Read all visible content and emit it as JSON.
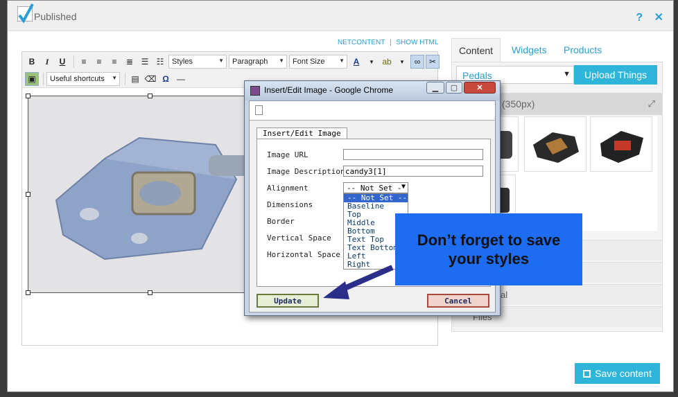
{
  "header": {
    "published_label": "Published"
  },
  "editor_links": {
    "netcontent": "NETCONTENT",
    "sep": "|",
    "show_html": "SHOW HTML"
  },
  "toolbar": {
    "bold": "B",
    "italic": "I",
    "underline": "U",
    "styles": "Styles",
    "paragraph": "Paragraph",
    "font_size": "Font Size",
    "text_color_glyph": "A",
    "shortcuts": "Useful shortcuts",
    "omega": "Ω",
    "hr": "—"
  },
  "right": {
    "tabs": [
      "Content",
      "Widgets",
      "Products"
    ],
    "folder_select": "Pedals",
    "upload_button": "Upload Things",
    "images_header": "(350px)",
    "accordion": [
      "",
      "0px)",
      "al",
      "Files"
    ]
  },
  "save_button": "Save content",
  "dialog": {
    "title": "Insert/Edit Image - Google Chrome",
    "tab": "Insert/Edit Image",
    "fields": {
      "image_url": {
        "label": "Image URL",
        "value": ""
      },
      "image_description": {
        "label": "Image Description",
        "value": "candy3[1]"
      },
      "alignment": {
        "label": "Alignment",
        "selected": "-- Not Set --"
      },
      "dimensions": {
        "label": "Dimensions"
      },
      "border": {
        "label": "Border"
      },
      "vertical_space": {
        "label": "Vertical Space"
      },
      "horizontal_space": {
        "label": "Horizontal Space"
      }
    },
    "alignment_options": [
      "-- Not Set --",
      "Baseline",
      "Top",
      "Middle",
      "Bottom",
      "Text Top",
      "Text Bottom",
      "Left",
      "Right"
    ],
    "update_button": "Update",
    "cancel_button": "Cancel"
  },
  "callout": {
    "line1": "Don’t forget to save",
    "line2": "your styles"
  },
  "colors": {
    "accent": "#2fb4da",
    "callout": "#1e6cf2"
  }
}
